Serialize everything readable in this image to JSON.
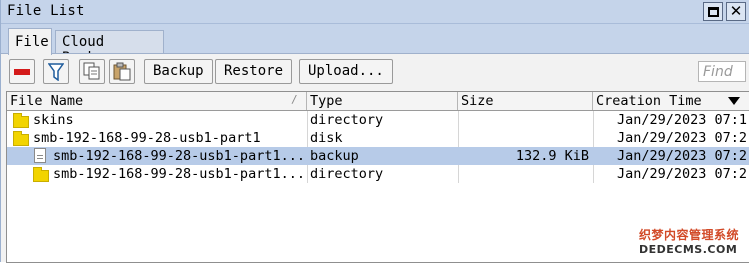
{
  "window": {
    "title": "File List"
  },
  "tabs": [
    {
      "label": "File"
    },
    {
      "label": "Cloud Backup"
    }
  ],
  "toolbar": {
    "backup_label": "Backup",
    "restore_label": "Restore",
    "upload_label": "Upload...",
    "find_placeholder": "Find"
  },
  "table": {
    "columns": [
      {
        "label": "File Name"
      },
      {
        "label": "Type"
      },
      {
        "label": "Size"
      },
      {
        "label": "Creation Time"
      }
    ],
    "rows": [
      {
        "name": "skins",
        "type": "directory",
        "size": "",
        "created": "Jan/29/2023 07:1",
        "icon": "folder-icon"
      },
      {
        "name": "smb-192-168-99-28-usb1-part1",
        "type": "disk",
        "size": "",
        "created": "Jan/29/2023 07:2",
        "icon": "folder-icon"
      },
      {
        "name": "smb-192-168-99-28-usb1-part1...",
        "type": "backup",
        "size": "132.9 KiB",
        "created": "Jan/29/2023 07:2",
        "icon": "file-icon",
        "selected": true
      },
      {
        "name": "smb-192-168-99-28-usb1-part1...",
        "type": "directory",
        "size": "",
        "created": "Jan/29/2023 07:2",
        "icon": "folder-icon"
      }
    ]
  },
  "watermark": {
    "line1": "织梦内容管理系统",
    "line2": "DEDECMS.COM"
  },
  "colors": {
    "titlebar": "#c5d4ea",
    "selected_row": "#b7cbe8",
    "folder": "#f2d400",
    "remove_icon": "#d41b1b"
  }
}
